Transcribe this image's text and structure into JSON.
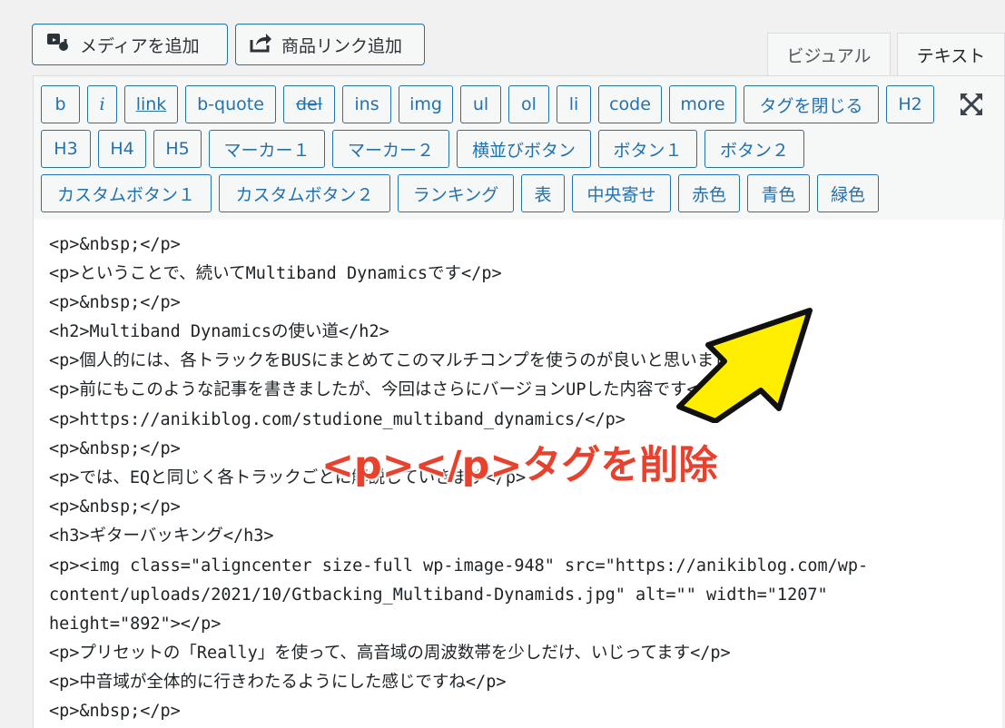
{
  "top_buttons": {
    "add_media": "メディアを追加",
    "add_product_link": "商品リンク追加"
  },
  "mode_tabs": {
    "visual": "ビジュアル",
    "text": "テキスト"
  },
  "quicktags": {
    "row1": [
      "b",
      "i",
      "link",
      "b-quote",
      "del",
      "ins",
      "img",
      "ul",
      "ol",
      "li",
      "code",
      "more",
      "タグを閉じる",
      "H2"
    ],
    "row2": [
      "H3",
      "H4",
      "H5",
      "マーカー１",
      "マーカー２",
      "横並びボタン",
      "ボタン１",
      "ボタン２"
    ],
    "row3": [
      "カスタムボタン１",
      "カスタムボタン２",
      "ランキング",
      "表",
      "中央寄せ",
      "赤色",
      "青色",
      "緑色"
    ]
  },
  "editor": {
    "lines": [
      "<p>&nbsp;</p>",
      "<p>ということで、続いてMultiband Dynamicsです</p>",
      "<p>&nbsp;</p>",
      "<h2>Multiband Dynamicsの使い道</h2>",
      "<p>個人的には、各トラックをBUSにまとめてこのマルチコンプを使うのが良いと思いました</p>",
      "<p>前にもこのような記事を書きましたが、今回はさらにバージョンUPした内容です</p>",
      "<p>https://anikiblog.com/studione_multiband_dynamics/</p>",
      "<p>&nbsp;</p>",
      "<p>では、EQと同じく各トラックごとに解説していきます</p>",
      "<p>&nbsp;</p>",
      "<h3>ギターバッキング</h3>",
      "<p><img class=\"aligncenter size-full wp-image-948\" src=\"https://anikiblog.com/wp-",
      "content/uploads/2021/10/Gtbacking_Multiband-Dynamids.jpg\" alt=\"\" width=\"1207\"",
      "height=\"892\"></p>",
      "<p>プリセットの「Really」を使って、高音域の周波数帯を少しだけ、いじってます</p>",
      "<p>中音域が全体的に行きわたるようにした感じですね</p>",
      "<p>&nbsp;</p>"
    ]
  },
  "annotation": {
    "text": "<p></p>タグを削除",
    "text_color": "#e8412d",
    "arrow_color": "#ffee00"
  },
  "colors": {
    "accent": "#2271b1",
    "toolbar_bg": "#f6f7f7",
    "page_bg": "#f1f1f1"
  }
}
